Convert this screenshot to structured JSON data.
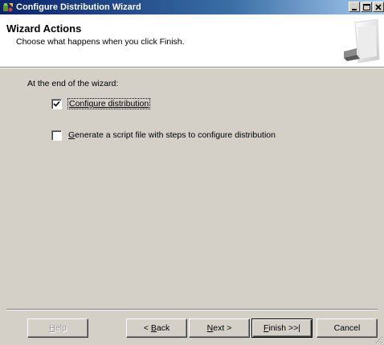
{
  "window": {
    "title": "Configure Distribution Wizard",
    "controls": [
      "minimize-icon",
      "maximize-icon",
      "close-icon"
    ]
  },
  "header": {
    "title": "Wizard Actions",
    "subtitle": "Choose what happens when you click Finish."
  },
  "body": {
    "prompt": "At the end of the wizard:",
    "options": [
      {
        "mnemonic": "",
        "label_underlined": "Configure distribution",
        "rest": "",
        "checked": true
      },
      {
        "mnemonic": "G",
        "label_rest": "enerate a script file with steps to configure distribution",
        "checked": false
      }
    ]
  },
  "buttons": {
    "help": {
      "pre": "",
      "u": "H",
      "post": "elp"
    },
    "back": {
      "pre": "< ",
      "u": "B",
      "post": "ack"
    },
    "next": {
      "pre": "",
      "u": "N",
      "post": "ext >"
    },
    "finish": {
      "pre": "",
      "u": "F",
      "post": "inish >>|"
    },
    "cancel": "Cancel"
  },
  "colors": {
    "titlebar_start": "#0a246a",
    "titlebar_end": "#a6caf0",
    "face": "#d4d0c8",
    "header_bg": "#ffffff"
  }
}
